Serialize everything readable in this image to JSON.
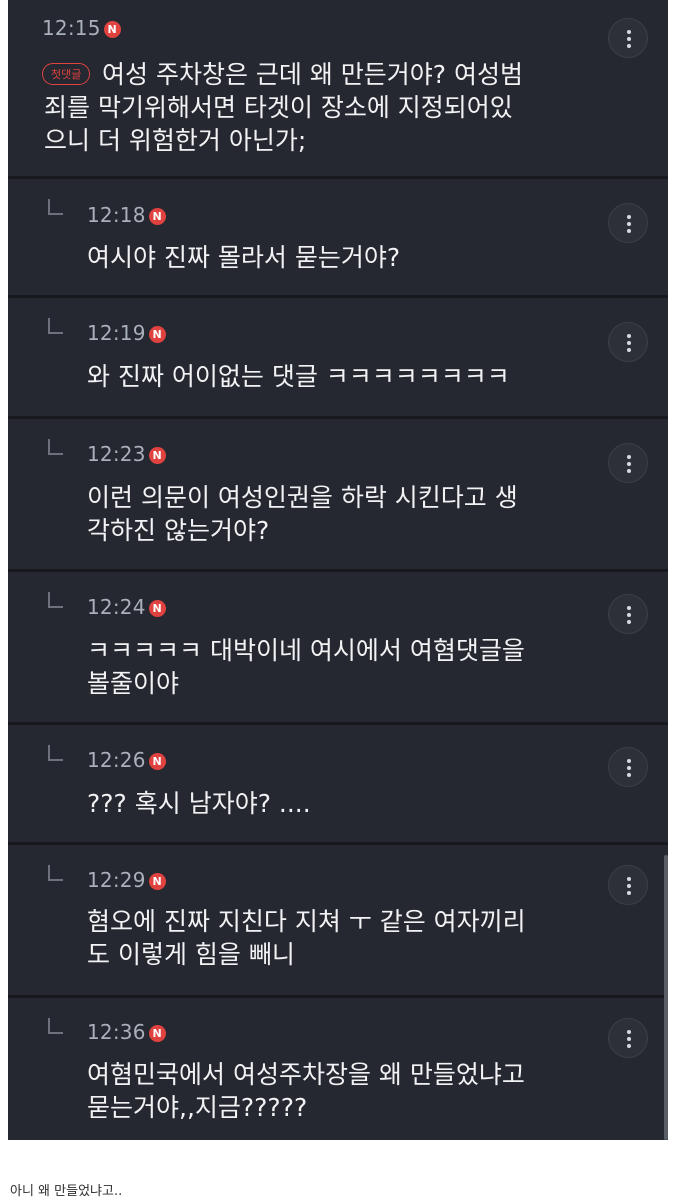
{
  "comments": [
    {
      "time": "12:15",
      "badge": "N",
      "first_label": "첫댓글",
      "lines": [
        "여성 주차창은 근데 왜 만든거야? 여성범",
        "죄를 막기위해서면 타겟이 장소에 지정되어있",
        "으니 더 위험한거 아닌가;"
      ]
    },
    {
      "time": "12:18",
      "badge": "N",
      "lines": [
        "여시야 진짜 몰라서 묻는거야?"
      ]
    },
    {
      "time": "12:19",
      "badge": "N",
      "lines": [
        "와 진짜 어이없는 댓글 ㅋㅋㅋㅋㅋㅋㅋㅋ"
      ]
    },
    {
      "time": "12:23",
      "badge": "N",
      "lines": [
        "이런 의문이 여성인권을 하락 시킨다고 생",
        "각하진 않는거야?"
      ]
    },
    {
      "time": "12:24",
      "badge": "N",
      "lines": [
        "ㅋㅋㅋㅋㅋ 대박이네 여시에서 여혐댓글을",
        "볼줄이야"
      ]
    },
    {
      "time": "12:26",
      "badge": "N",
      "lines": [
        "??? 혹시 남자야? ...."
      ]
    },
    {
      "time": "12:29",
      "badge": "N",
      "lines": [
        "혐오에 진짜 지친다 지쳐 ㅜ 같은 여자끼리",
        "도 이렇게 힘을 빼니"
      ]
    },
    {
      "time": "12:36",
      "badge": "N",
      "lines": [
        "여혐민국에서 여성주차장을 왜 만들었냐고",
        "묻는거야,,지금?????"
      ]
    }
  ],
  "caption": "아니 왜 만들었냐고..",
  "icons": {
    "more": "more-vertical-icon",
    "reply": "reply-arrow-icon",
    "new": "new-badge-icon"
  },
  "colors": {
    "background": "#252830",
    "text": "#f2f2f4",
    "time": "#aab0b9",
    "accent": "#e0433f"
  }
}
